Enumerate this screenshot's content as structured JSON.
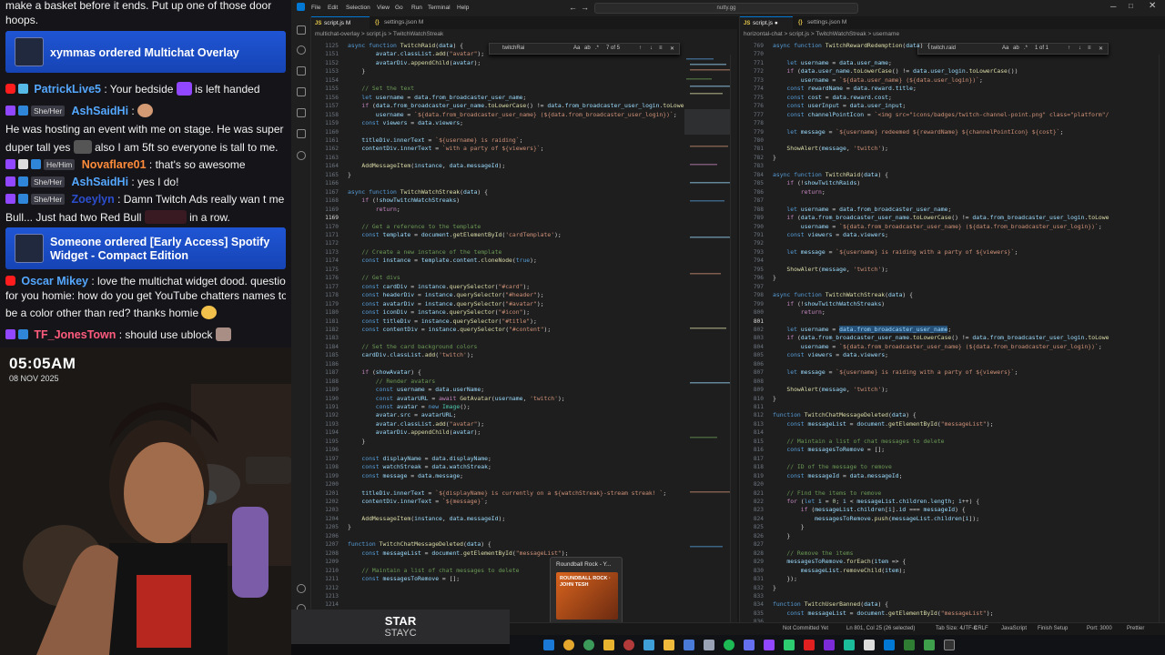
{
  "chat": {
    "top_partial": "make a basket before it ends. Put up one of those door hoops.",
    "banner1": {
      "text": "xymmas ordered Multichat Overlay"
    },
    "m1": {
      "user": "PatrickLive5",
      "before": ": Your bedside",
      "after": "is left handed"
    },
    "m2": {
      "user": "AshSaidHi",
      "text": ":"
    },
    "m2b": {
      "line1": "He was hosting an event with me on stage. He was super",
      "line2a": "duper tall yes",
      "line2b": "also I am 5ft so everyone is tall to me."
    },
    "m3": {
      "pronoun": "He/Him",
      "user": "Novaflare01",
      "text": ": that's so awesome"
    },
    "m4": {
      "pronoun": "She/Her",
      "user": "AshSaidHi",
      "text": ": yes I do!"
    },
    "m5": {
      "pronoun": "She/Her",
      "user": "Zoeylyn",
      "line1": ": Damn Twitch Ads really wan t me to get Red",
      "line2a": "Bull... Just had two Red Bull",
      "line2b": "in a row."
    },
    "banner2": {
      "line1": "Someone ordered [Early Access] Spotify",
      "line2": "Widget - Compact Edition"
    },
    "m6": {
      "user": "Oscar Mikey",
      "line1": ": love the multichat widget dood. question",
      "line2": "for you homie: how do you get YouTube chatters names to",
      "line3": "be a color other than red? thanks homie"
    },
    "m7": {
      "user": "TF_JonesTown",
      "text": ": should use ublock"
    }
  },
  "clock": {
    "time": "05:05AM",
    "date": "08 NOV 2025"
  },
  "music": {
    "song": "STAR",
    "artist": "STAYC"
  },
  "vscode": {
    "menu": [
      "File",
      "Edit",
      "Selection",
      "View",
      "Go",
      "Run",
      "Terminal",
      "Help"
    ],
    "search": "nutty.gg",
    "left": {
      "tabs": [
        "script.js M",
        "settings.json M"
      ],
      "breadcrumb": "multichat-overlay  >  script.js  >  TwitchWatchStreak",
      "find": {
        "query": "twitchRai",
        "count": "7 of 5",
        "aa": "Aa",
        "ab": "ab",
        "re": ".*"
      }
    },
    "right": {
      "tabs": [
        "script.js",
        "settings.json M"
      ],
      "breadcrumb": "horizontal-chat  >  script.js  >  TwitchWatchStreak  >  username",
      "find": {
        "query": "twitch.raid",
        "count": "1 of 1",
        "aa": "Aa",
        "ab": "ab",
        "re": ".*"
      }
    },
    "preview": {
      "title": "Roundball Rock - Y...",
      "label": "ROUNDBALL ROCK · JOHN TESH"
    },
    "status": {
      "branch": "Not Committed Yet",
      "pos": "Ln 801, Col 25 (26 selected)",
      "tab": "Tab Size: 4",
      "enc": "UTF-8",
      "eol": "CRLF",
      "lang": "JavaScript",
      "finish": "Finish Setup",
      "port": "Port: 3000",
      "prettier": "Prettier"
    }
  },
  "colors": {
    "accent": "#0078d4",
    "banner": "#1f55d4",
    "user": "#55a8ff"
  }
}
